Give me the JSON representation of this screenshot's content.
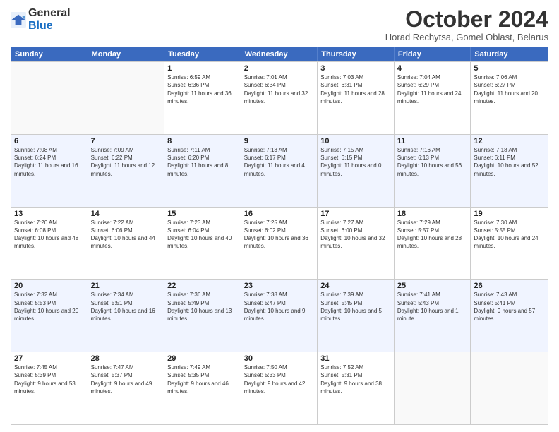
{
  "logo": {
    "general": "General",
    "blue": "Blue"
  },
  "title": "October 2024",
  "location": "Horad Rechytsa, Gomel Oblast, Belarus",
  "header_days": [
    "Sunday",
    "Monday",
    "Tuesday",
    "Wednesday",
    "Thursday",
    "Friday",
    "Saturday"
  ],
  "weeks": [
    [
      {
        "day": "",
        "text": ""
      },
      {
        "day": "",
        "text": ""
      },
      {
        "day": "1",
        "text": "Sunrise: 6:59 AM\nSunset: 6:36 PM\nDaylight: 11 hours and 36 minutes."
      },
      {
        "day": "2",
        "text": "Sunrise: 7:01 AM\nSunset: 6:34 PM\nDaylight: 11 hours and 32 minutes."
      },
      {
        "day": "3",
        "text": "Sunrise: 7:03 AM\nSunset: 6:31 PM\nDaylight: 11 hours and 28 minutes."
      },
      {
        "day": "4",
        "text": "Sunrise: 7:04 AM\nSunset: 6:29 PM\nDaylight: 11 hours and 24 minutes."
      },
      {
        "day": "5",
        "text": "Sunrise: 7:06 AM\nSunset: 6:27 PM\nDaylight: 11 hours and 20 minutes."
      }
    ],
    [
      {
        "day": "6",
        "text": "Sunrise: 7:08 AM\nSunset: 6:24 PM\nDaylight: 11 hours and 16 minutes."
      },
      {
        "day": "7",
        "text": "Sunrise: 7:09 AM\nSunset: 6:22 PM\nDaylight: 11 hours and 12 minutes."
      },
      {
        "day": "8",
        "text": "Sunrise: 7:11 AM\nSunset: 6:20 PM\nDaylight: 11 hours and 8 minutes."
      },
      {
        "day": "9",
        "text": "Sunrise: 7:13 AM\nSunset: 6:17 PM\nDaylight: 11 hours and 4 minutes."
      },
      {
        "day": "10",
        "text": "Sunrise: 7:15 AM\nSunset: 6:15 PM\nDaylight: 11 hours and 0 minutes."
      },
      {
        "day": "11",
        "text": "Sunrise: 7:16 AM\nSunset: 6:13 PM\nDaylight: 10 hours and 56 minutes."
      },
      {
        "day": "12",
        "text": "Sunrise: 7:18 AM\nSunset: 6:11 PM\nDaylight: 10 hours and 52 minutes."
      }
    ],
    [
      {
        "day": "13",
        "text": "Sunrise: 7:20 AM\nSunset: 6:08 PM\nDaylight: 10 hours and 48 minutes."
      },
      {
        "day": "14",
        "text": "Sunrise: 7:22 AM\nSunset: 6:06 PM\nDaylight: 10 hours and 44 minutes."
      },
      {
        "day": "15",
        "text": "Sunrise: 7:23 AM\nSunset: 6:04 PM\nDaylight: 10 hours and 40 minutes."
      },
      {
        "day": "16",
        "text": "Sunrise: 7:25 AM\nSunset: 6:02 PM\nDaylight: 10 hours and 36 minutes."
      },
      {
        "day": "17",
        "text": "Sunrise: 7:27 AM\nSunset: 6:00 PM\nDaylight: 10 hours and 32 minutes."
      },
      {
        "day": "18",
        "text": "Sunrise: 7:29 AM\nSunset: 5:57 PM\nDaylight: 10 hours and 28 minutes."
      },
      {
        "day": "19",
        "text": "Sunrise: 7:30 AM\nSunset: 5:55 PM\nDaylight: 10 hours and 24 minutes."
      }
    ],
    [
      {
        "day": "20",
        "text": "Sunrise: 7:32 AM\nSunset: 5:53 PM\nDaylight: 10 hours and 20 minutes."
      },
      {
        "day": "21",
        "text": "Sunrise: 7:34 AM\nSunset: 5:51 PM\nDaylight: 10 hours and 16 minutes."
      },
      {
        "day": "22",
        "text": "Sunrise: 7:36 AM\nSunset: 5:49 PM\nDaylight: 10 hours and 13 minutes."
      },
      {
        "day": "23",
        "text": "Sunrise: 7:38 AM\nSunset: 5:47 PM\nDaylight: 10 hours and 9 minutes."
      },
      {
        "day": "24",
        "text": "Sunrise: 7:39 AM\nSunset: 5:45 PM\nDaylight: 10 hours and 5 minutes."
      },
      {
        "day": "25",
        "text": "Sunrise: 7:41 AM\nSunset: 5:43 PM\nDaylight: 10 hours and 1 minute."
      },
      {
        "day": "26",
        "text": "Sunrise: 7:43 AM\nSunset: 5:41 PM\nDaylight: 9 hours and 57 minutes."
      }
    ],
    [
      {
        "day": "27",
        "text": "Sunrise: 7:45 AM\nSunset: 5:39 PM\nDaylight: 9 hours and 53 minutes."
      },
      {
        "day": "28",
        "text": "Sunrise: 7:47 AM\nSunset: 5:37 PM\nDaylight: 9 hours and 49 minutes."
      },
      {
        "day": "29",
        "text": "Sunrise: 7:49 AM\nSunset: 5:35 PM\nDaylight: 9 hours and 46 minutes."
      },
      {
        "day": "30",
        "text": "Sunrise: 7:50 AM\nSunset: 5:33 PM\nDaylight: 9 hours and 42 minutes."
      },
      {
        "day": "31",
        "text": "Sunrise: 7:52 AM\nSunset: 5:31 PM\nDaylight: 9 hours and 38 minutes."
      },
      {
        "day": "",
        "text": ""
      },
      {
        "day": "",
        "text": ""
      }
    ]
  ]
}
